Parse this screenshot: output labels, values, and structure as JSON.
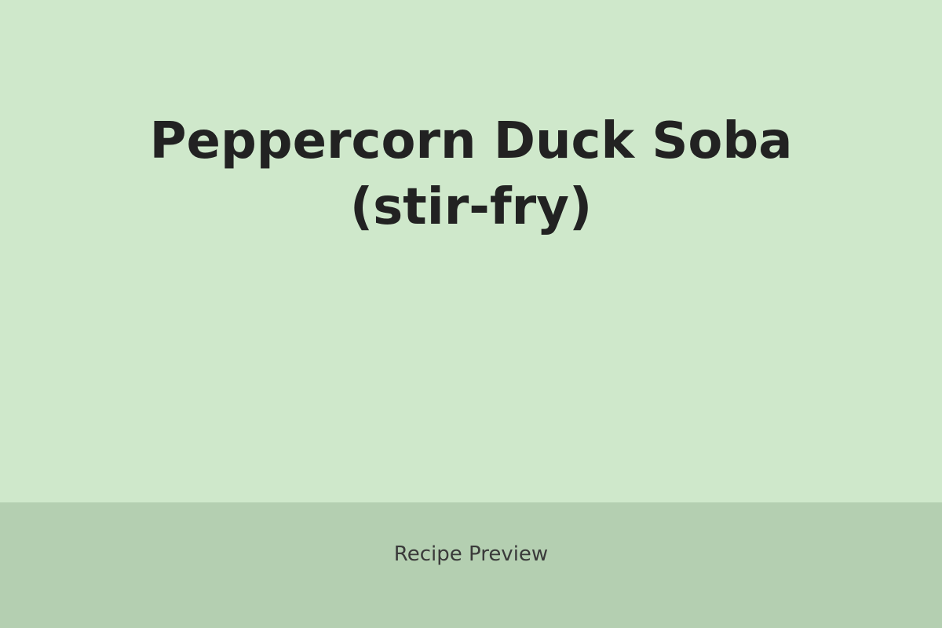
{
  "recipe": {
    "title_line1": "Peppercorn Duck Soba",
    "title_line2": "(stir-fry)"
  },
  "footer": {
    "label": "Recipe Preview"
  },
  "colors": {
    "background": "#cfe8cb",
    "footer_background": "#b4cfb1",
    "title_text": "#222222",
    "footer_text": "#3a3a3a"
  }
}
